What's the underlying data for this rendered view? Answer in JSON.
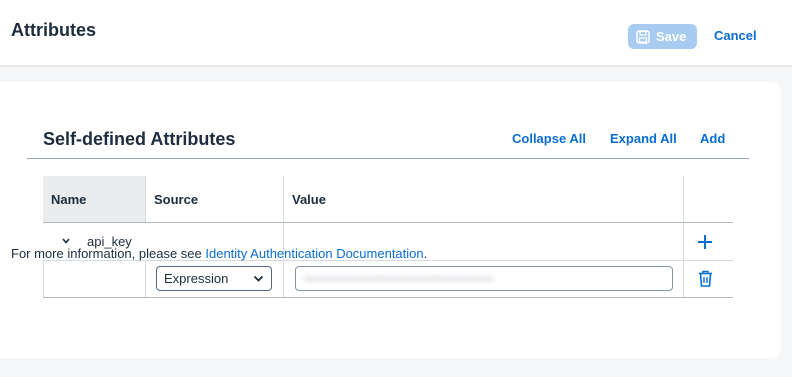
{
  "header": {
    "title": "Attributes",
    "save_label": "Save",
    "cancel_label": "Cancel"
  },
  "section": {
    "title": "Self-defined Attributes",
    "collapse_all": "Collapse All",
    "expand_all": "Expand All",
    "add": "Add"
  },
  "table": {
    "columns": [
      "Name",
      "Source",
      "Value"
    ],
    "rows": [
      {
        "name": "api_key",
        "source": "Expression",
        "value": "•••••••••••••••••••••••••••••••••••••••••••••"
      }
    ]
  },
  "footer": {
    "text": "For more information, please see ",
    "link": "Identity Authentication Documentation",
    "suffix": "."
  },
  "colors": {
    "accent": "#0a6ed1",
    "save_disabled": "#a8ccf1",
    "header_bg": "#eaecee"
  },
  "icons": [
    "save-icon",
    "chevron-down-icon",
    "add-icon",
    "trash-icon",
    "dropdown-arrow-icon"
  ]
}
